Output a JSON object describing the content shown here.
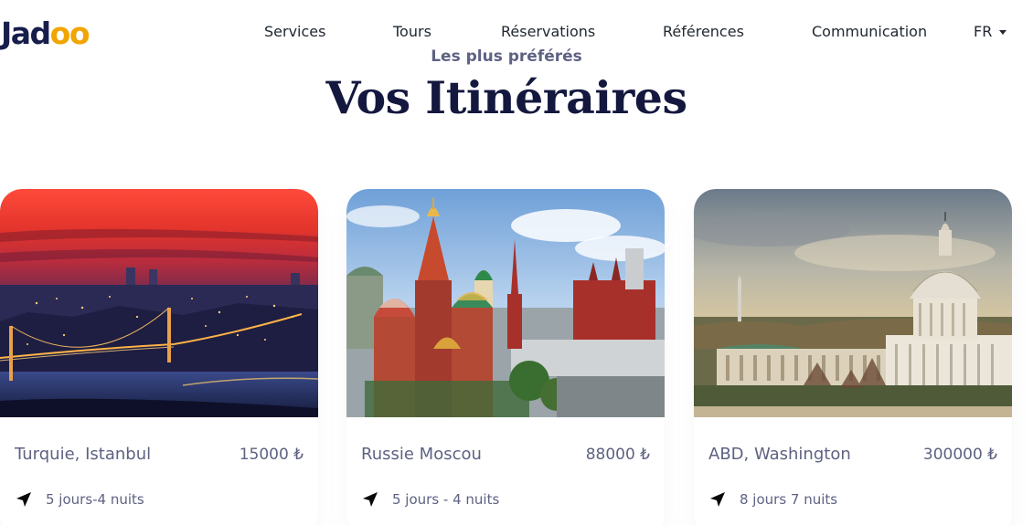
{
  "brand": {
    "logo_text": "Jad",
    "logo_dots": "oo"
  },
  "nav": {
    "items": [
      "Services",
      "Tours",
      "Réservations",
      "Références",
      "Communication"
    ],
    "language": "FR"
  },
  "section": {
    "subtitle": "Les plus préférés",
    "title": "Vos Itinéraires"
  },
  "cards": [
    {
      "city": "Turquie, Istanbul",
      "price": "15000 ₺",
      "duration": "5 jours-4 nuits",
      "icon": "navigation-arrow-icon"
    },
    {
      "city": "Russie Moscou",
      "price": "88000 ₺",
      "duration": "5 jours - 4 nuits",
      "icon": "navigation-arrow-icon"
    },
    {
      "city": "ABD, Washington",
      "price": "300000 ₺",
      "duration": "8 jours 7 nuits",
      "icon": "navigation-arrow-icon"
    }
  ],
  "colors": {
    "heading": "#14183e",
    "text": "#5e6282",
    "accent": "#f1a501"
  }
}
